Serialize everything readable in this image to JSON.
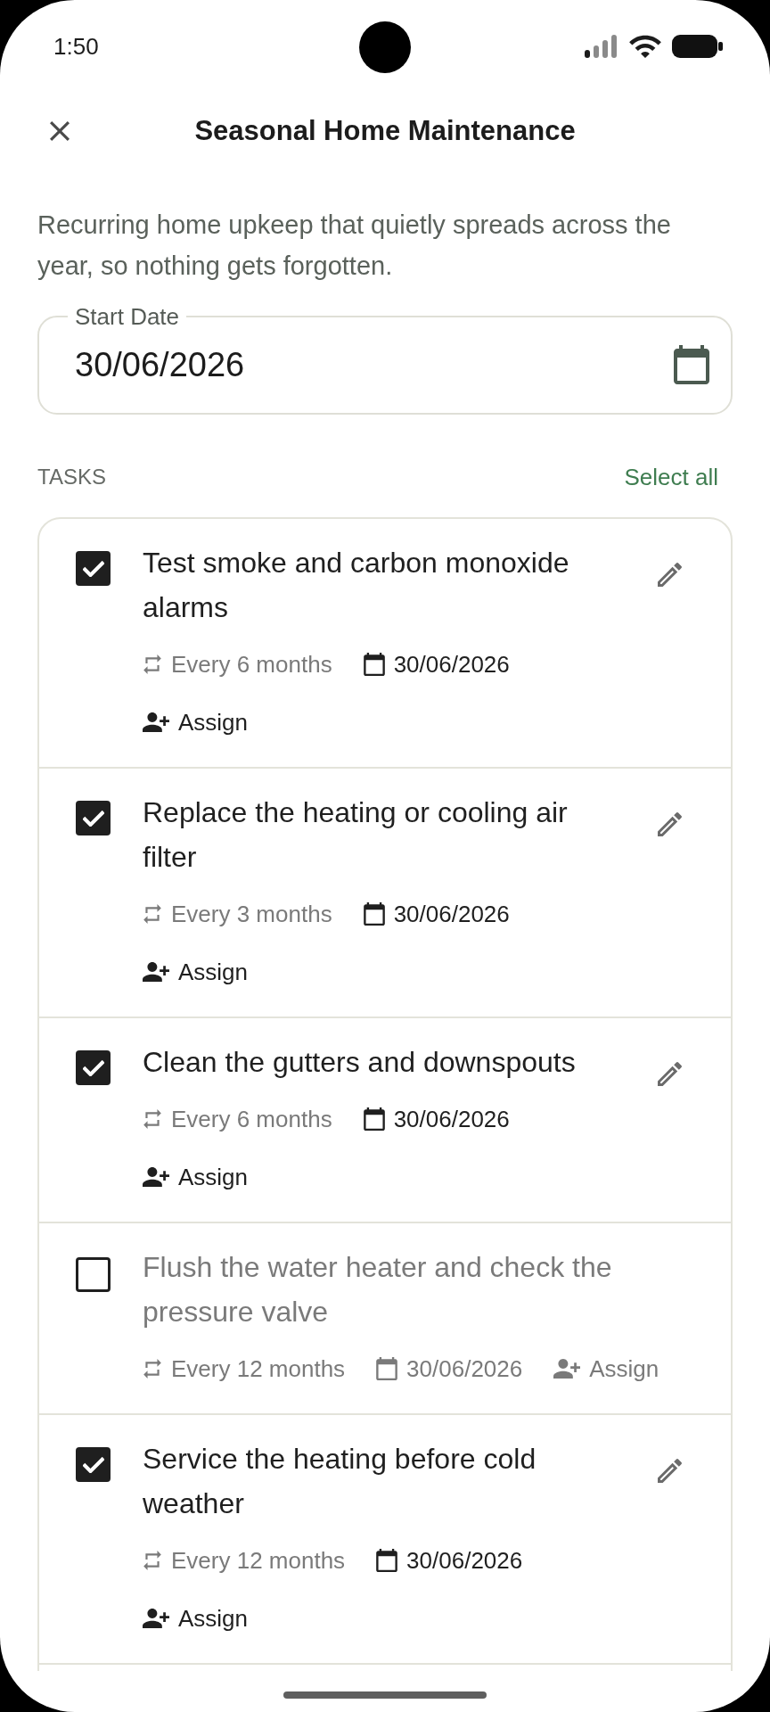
{
  "status_bar": {
    "time": "1:50"
  },
  "header": {
    "title": "Seasonal Home Maintenance"
  },
  "description": "Recurring home upkeep that quietly spreads across the year, so nothing gets forgotten.",
  "start_date": {
    "label": "Start Date",
    "value": "30/06/2026"
  },
  "tasks_header": {
    "label": "TASKS",
    "action": "Select all"
  },
  "tasks": [
    {
      "title": "Test smoke and carbon monoxide alarms",
      "checked": true,
      "repeat": "Every 6 months",
      "date": "30/06/2026",
      "assign": "Assign"
    },
    {
      "title": "Replace the heating or cooling air filter",
      "checked": true,
      "repeat": "Every 3 months",
      "date": "30/06/2026",
      "assign": "Assign"
    },
    {
      "title": "Clean the gutters and downspouts",
      "checked": true,
      "repeat": "Every 6 months",
      "date": "30/06/2026",
      "assign": "Assign"
    },
    {
      "title": "Flush the water heater and check the pressure valve",
      "checked": false,
      "repeat": "Every 12 months",
      "date": "30/06/2026",
      "assign": "Assign"
    },
    {
      "title": "Service the heating before cold weather",
      "checked": true,
      "repeat": "Every 12 months",
      "date": "30/06/2026",
      "assign": "Assign"
    }
  ]
}
